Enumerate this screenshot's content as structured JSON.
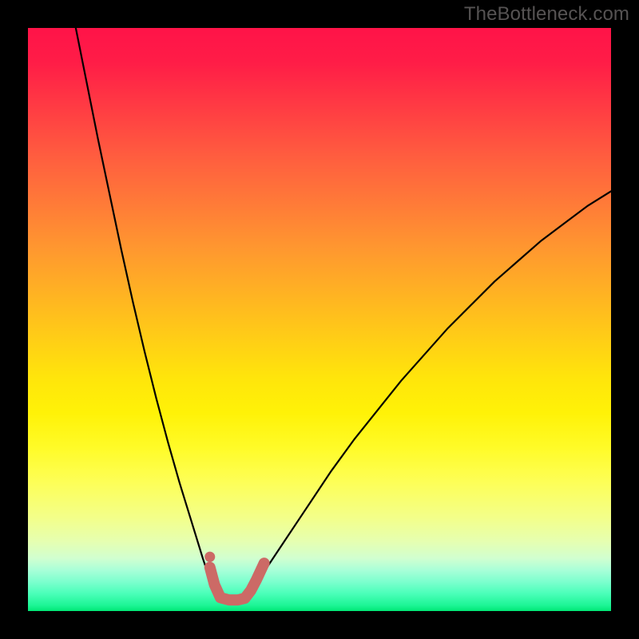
{
  "watermark": "TheBottleneck.com",
  "colors": {
    "frame": "#000000",
    "watermark_text": "#565353",
    "curve_stroke": "#000000",
    "marker_fill": "#cc6a66",
    "gradient_top": "#ff1348",
    "gradient_bottom": "#00e876"
  },
  "chart_data": {
    "type": "line",
    "title": "",
    "xlabel": "",
    "ylabel": "",
    "xlim": [
      0,
      100
    ],
    "ylim": [
      0,
      100
    ],
    "grid": false,
    "note": "Axis values and units are not shown in the image; x and y are expressed as 0–100 percent of plot width/height, with y=0 at the bottom edge. Each curve is a sequence of (x,y) points.",
    "series": [
      {
        "name": "left_descending_curve",
        "x": [
          8.2,
          10,
          12,
          14,
          16,
          18,
          20,
          22,
          24,
          26,
          28,
          30,
          31,
          32
        ],
        "y": [
          100,
          91,
          81,
          71.5,
          62,
          53,
          44.5,
          36.5,
          29,
          22,
          15.5,
          9,
          6,
          3.5
        ]
      },
      {
        "name": "right_ascending_curve",
        "x": [
          38,
          40,
          44,
          48,
          52,
          56,
          60,
          64,
          68,
          72,
          76,
          80,
          84,
          88,
          92,
          96,
          100
        ],
        "y": [
          3.5,
          6,
          12,
          18,
          24,
          29.5,
          34.5,
          39.5,
          44,
          48.5,
          52.5,
          56.5,
          60,
          63.5,
          66.5,
          69.5,
          72
        ]
      },
      {
        "name": "bottom_flat_segment",
        "x": [
          33,
          34,
          35,
          36,
          37,
          38
        ],
        "y": [
          2.2,
          2.0,
          1.9,
          1.9,
          2.0,
          2.2
        ]
      }
    ],
    "markers": {
      "name": "highlighted_points",
      "note": "Rounded salmon markers drawn over the bottom of the V shape.",
      "points": [
        {
          "x": 31.2,
          "y": 7.5
        },
        {
          "x": 32.0,
          "y": 4.5
        },
        {
          "x": 33.0,
          "y": 2.3
        },
        {
          "x": 34.5,
          "y": 1.9
        },
        {
          "x": 36.0,
          "y": 1.9
        },
        {
          "x": 37.2,
          "y": 2.2
        },
        {
          "x": 38.2,
          "y": 3.5
        },
        {
          "x": 39.2,
          "y": 5.4
        },
        {
          "x": 40.5,
          "y": 8.2
        }
      ]
    }
  }
}
